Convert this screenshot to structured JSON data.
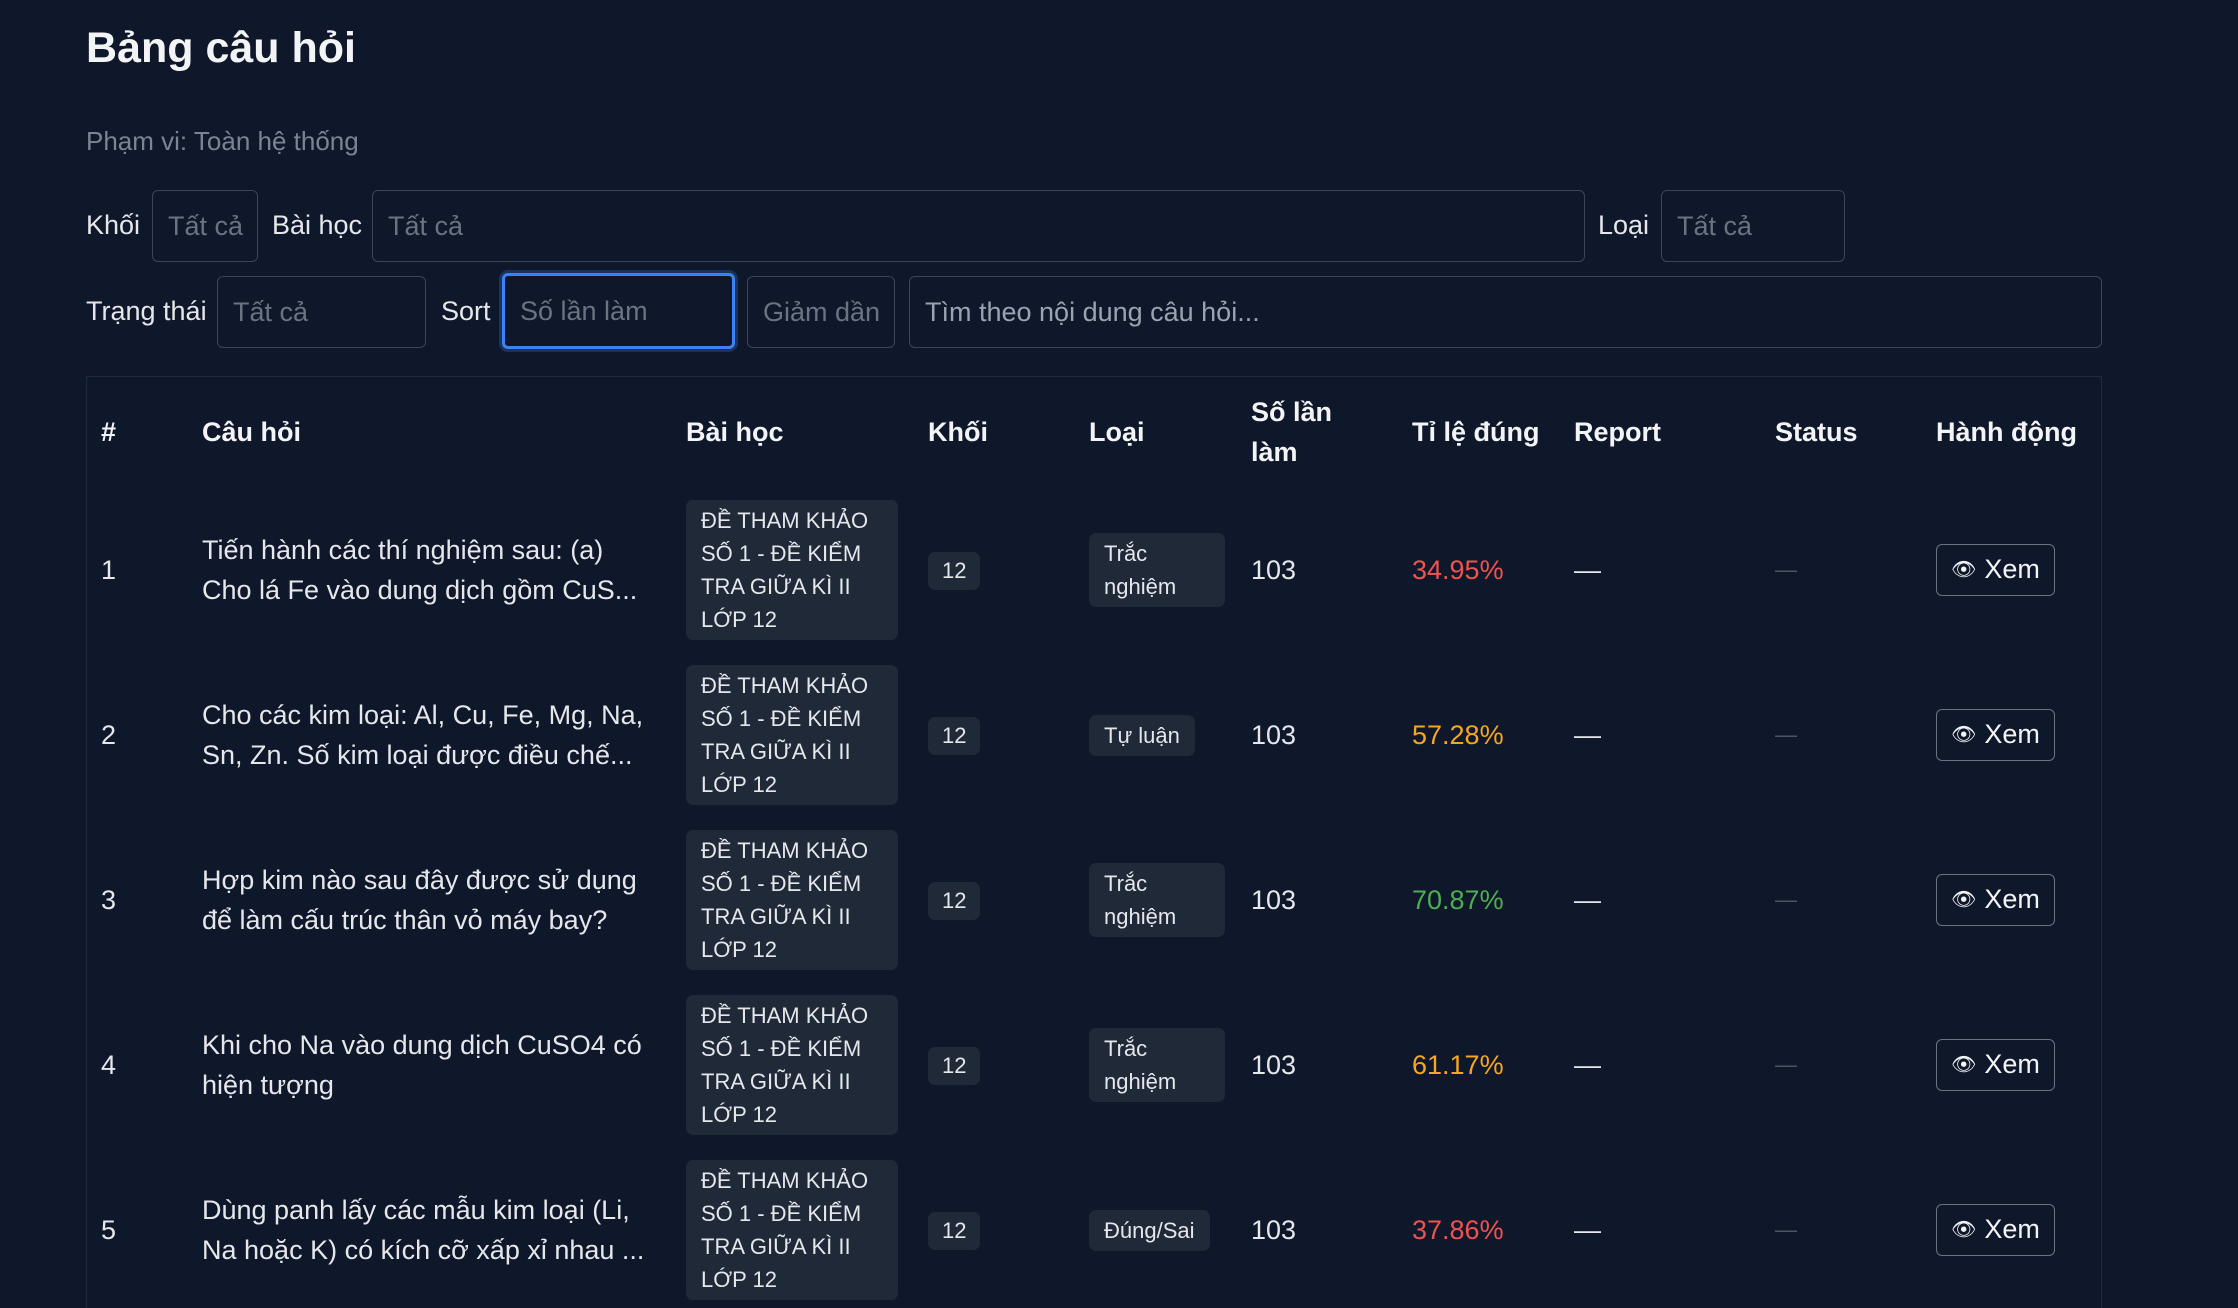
{
  "page": {
    "title": "Bảng câu hỏi",
    "scope": "Phạm vi: Toàn hệ thống"
  },
  "filters": {
    "grade_label": "Khối",
    "grade_value": "Tất cả",
    "lesson_label": "Bài học",
    "lesson_value": "Tất cả",
    "type_label": "Loại",
    "type_value": "Tất cả",
    "status_label": "Trạng thái",
    "status_value": "Tất cả",
    "sort_label": "Sort",
    "sort_field": "Số lần làm",
    "sort_order": "Giảm dần",
    "search_placeholder": "Tìm theo nội dung câu hỏi..."
  },
  "table": {
    "headers": {
      "index": "#",
      "question": "Câu hỏi",
      "lesson": "Bài học",
      "grade": "Khối",
      "type": "Loại",
      "attempts": "Số lần làm",
      "correct_rate": "Tỉ lệ đúng",
      "report": "Report",
      "status": "Status",
      "actions": "Hành động"
    },
    "view_label": "Xem",
    "rows": [
      {
        "index": "1",
        "question": "Tiến hành các thí nghiệm sau: (a) Cho lá Fe vào dung dịch gồm CuS...",
        "lesson": "ĐỀ THAM KHẢO SỐ 1 - ĐỀ KIỂM TRA GIỮA KÌ II LỚP 12",
        "grade": "12",
        "type": "Trắc nghiệm",
        "attempts": "103",
        "rate": "34.95%",
        "rate_color": "#ef5350",
        "report": "—",
        "status": "—"
      },
      {
        "index": "2",
        "question": "Cho các kim loại: Al, Cu, Fe, Mg, Na, Sn, Zn. Số kim loại được điều chế...",
        "lesson": "ĐỀ THAM KHẢO SỐ 1 - ĐỀ KIỂM TRA GIỮA KÌ II LỚP 12",
        "grade": "12",
        "type": "Tự luận",
        "attempts": "103",
        "rate": "57.28%",
        "rate_color": "#f5a623",
        "report": "—",
        "status": "—"
      },
      {
        "index": "3",
        "question": "Hợp kim nào sau đây được sử dụng để làm cấu trúc thân vỏ máy bay?",
        "lesson": "ĐỀ THAM KHẢO SỐ 1 - ĐỀ KIỂM TRA GIỮA KÌ II LỚP 12",
        "grade": "12",
        "type": "Trắc nghiệm",
        "attempts": "103",
        "rate": "70.87%",
        "rate_color": "#4caf50",
        "report": "—",
        "status": "—"
      },
      {
        "index": "4",
        "question": "Khi cho Na vào dung dịch CuSO4 có hiện tượng",
        "lesson": "ĐỀ THAM KHẢO SỐ 1 - ĐỀ KIỂM TRA GIỮA KÌ II LỚP 12",
        "grade": "12",
        "type": "Trắc nghiệm",
        "attempts": "103",
        "rate": "61.17%",
        "rate_color": "#f5a623",
        "report": "—",
        "status": "—"
      },
      {
        "index": "5",
        "question": "Dùng panh lấy các mẫu kim loại (Li, Na hoặc K) có kích cỡ xấp xỉ nhau ...",
        "lesson": "ĐỀ THAM KHẢO SỐ 1 - ĐỀ KIỂM TRA GIỮA KÌ II LỚP 12",
        "grade": "12",
        "type": "Đúng/Sai",
        "attempts": "103",
        "rate": "37.86%",
        "rate_color": "#ef5350",
        "report": "—",
        "status": "—"
      }
    ]
  }
}
